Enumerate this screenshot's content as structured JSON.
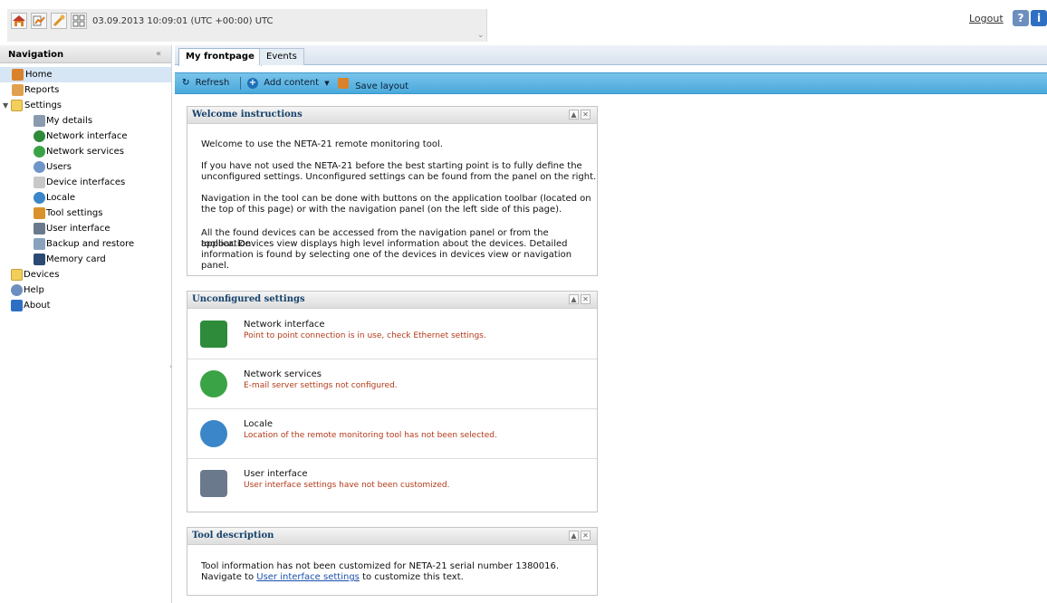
{
  "header": {
    "datetime": "03.09.2013 10:09:01 (UTC +00:00) UTC",
    "logout": "Logout",
    "toolbar_icons": [
      "home-icon",
      "reports-icon",
      "settings-icon",
      "devices-icon"
    ],
    "help_icon": "help-icon",
    "info_icon": "info-icon"
  },
  "nav": {
    "title": "Navigation",
    "items": [
      {
        "label": "Home",
        "icon": "home-icon"
      },
      {
        "label": "Reports",
        "icon": "reports-icon"
      },
      {
        "label": "Settings",
        "icon": "folder-open-icon"
      },
      {
        "label": "My details",
        "icon": "details-icon"
      },
      {
        "label": "Network interface",
        "icon": "network-interface-icon"
      },
      {
        "label": "Network services",
        "icon": "network-services-icon"
      },
      {
        "label": "Users",
        "icon": "users-icon"
      },
      {
        "label": "Device interfaces",
        "icon": "device-interfaces-icon"
      },
      {
        "label": "Locale",
        "icon": "globe-icon"
      },
      {
        "label": "Tool settings",
        "icon": "tool-settings-icon"
      },
      {
        "label": "User interface",
        "icon": "user-interface-icon"
      },
      {
        "label": "Backup and restore",
        "icon": "backup-icon"
      },
      {
        "label": "Memory card",
        "icon": "memory-card-icon"
      },
      {
        "label": "Devices",
        "icon": "folder-icon"
      },
      {
        "label": "Help",
        "icon": "help-icon"
      },
      {
        "label": "About",
        "icon": "info-icon"
      }
    ]
  },
  "tabs": [
    "My frontpage",
    "Events"
  ],
  "toolbar": {
    "refresh": "Refresh",
    "add_content": "Add content",
    "save_layout": "Save layout"
  },
  "welcome": {
    "title": "Welcome instructions",
    "p1": "Welcome to use the NETA-21 remote monitoring tool.",
    "p2a": "If you have not used the NETA-21 before the best starting point is to fully define the",
    "p2b": "unconfigured settings. Unconfigured settings can be found from the panel on the right.",
    "p3a": "Navigation in the tool can be done with buttons on the application toolbar (located on",
    "p3b": "the top of this page) or with the navigation panel (on the left side of this page).",
    "p4a": "All the found devices can be accessed from the navigation panel or from the application",
    "p4b": "toolbar. Devices view displays high level information about the devices. Detailed",
    "p4c": "information is found by selecting one of the devices in devices view or navigation panel."
  },
  "unconfigured": {
    "title": "Unconfigured settings",
    "rows": [
      {
        "title": "Network interface",
        "desc": "Point to point connection is in use, check Ethernet settings.",
        "icon": "network-interface-icon",
        "color": "#2e8b3a"
      },
      {
        "title": "Network services",
        "desc": "E-mail server settings not configured.",
        "icon": "network-services-icon",
        "color": "#3aa346"
      },
      {
        "title": "Locale",
        "desc": "Location of the remote monitoring tool has not been selected.",
        "icon": "globe-icon",
        "color": "#3a86c8"
      },
      {
        "title": "User interface",
        "desc": "User interface settings have not been customized.",
        "icon": "user-interface-icon",
        "color": "#6a7a8c"
      }
    ]
  },
  "tool_description": {
    "title": "Tool description",
    "line1": "Tool information has not been customized for NETA-21 serial number 1380016.",
    "line2_pre": "Navigate to ",
    "line2_link": "User interface settings",
    "line2_post": " to customize this text."
  }
}
